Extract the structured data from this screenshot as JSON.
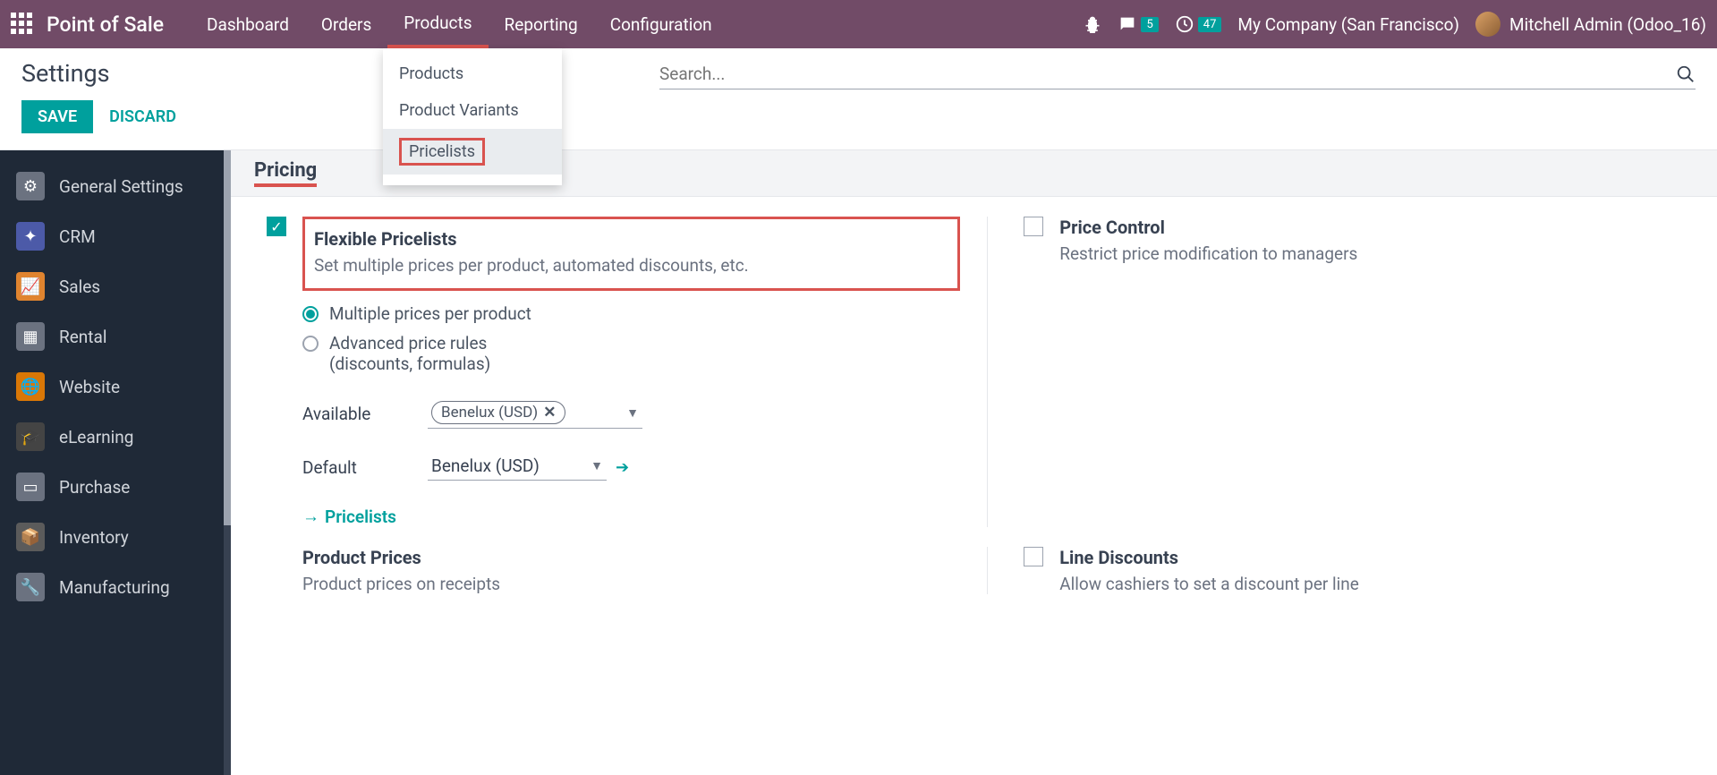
{
  "topnav": {
    "brand": "Point of Sale",
    "items": [
      "Dashboard",
      "Orders",
      "Products",
      "Reporting",
      "Configuration"
    ],
    "active_index": 2,
    "msg_badge": "5",
    "clock_badge": "47",
    "company": "My Company (San Francisco)",
    "user": "Mitchell Admin (Odoo_16)"
  },
  "dropdown": {
    "items": [
      "Products",
      "Product Variants",
      "Pricelists"
    ],
    "highlighted_index": 2
  },
  "control_panel": {
    "title": "Settings",
    "save": "SAVE",
    "discard": "DISCARD",
    "search_placeholder": "Search..."
  },
  "sidebar": {
    "items": [
      {
        "label": "General Settings",
        "color": "#6b7280"
      },
      {
        "label": "CRM",
        "color": "#4c5aa8"
      },
      {
        "label": "Sales",
        "color": "#e0842f"
      },
      {
        "label": "Rental",
        "color": "#6b7280"
      },
      {
        "label": "Website",
        "color": "#d97706"
      },
      {
        "label": "eLearning",
        "color": "#444"
      },
      {
        "label": "Purchase",
        "color": "#6b7280"
      },
      {
        "label": "Inventory",
        "color": "#5b5b5b"
      },
      {
        "label": "Manufacturing",
        "color": "#6b7280"
      }
    ]
  },
  "section": {
    "title": "Pricing"
  },
  "settings": {
    "flexible": {
      "title": "Flexible Pricelists",
      "desc": "Set multiple prices per product, automated discounts, etc.",
      "radio1": "Multiple prices per product",
      "radio2_l1": "Advanced price rules",
      "radio2_l2": "(discounts, formulas)",
      "available_label": "Available",
      "available_tag": "Benelux (USD)",
      "default_label": "Default",
      "default_value": "Benelux (USD)",
      "pricelists_link": "Pricelists"
    },
    "price_control": {
      "title": "Price Control",
      "desc": "Restrict price modification to managers"
    },
    "product_prices": {
      "title": "Product Prices",
      "desc": "Product prices on receipts"
    },
    "line_discounts": {
      "title": "Line Discounts",
      "desc": "Allow cashiers to set a discount per line"
    }
  }
}
